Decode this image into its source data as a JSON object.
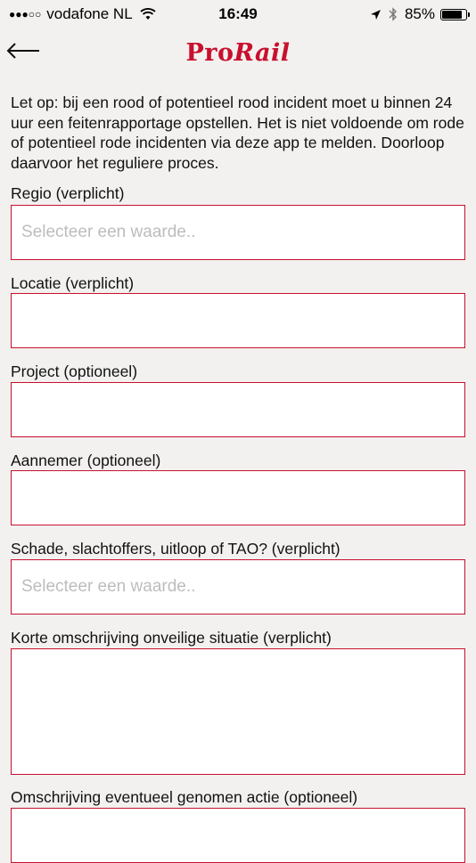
{
  "status_bar": {
    "carrier": "vodafone NL",
    "time": "16:49",
    "battery": "85%",
    "battery_level": 0.85
  },
  "header": {
    "logo_part1": "Pro",
    "logo_part2": "Rail"
  },
  "notice": "Let op: bij een rood of potentieel rood incident moet u binnen 24 uur een feitenrapportage opstellen. Het is niet voldoende om rode of potentieel rode incidenten via deze app te melden. Doorloop daarvoor het reguliere proces.",
  "form": {
    "regio_label": "Regio (verplicht)",
    "regio_placeholder": "Selecteer een waarde..",
    "locatie_label": "Locatie (verplicht)",
    "project_label": "Project (optioneel)",
    "aannemer_label": "Aannemer (optioneel)",
    "schade_label": "Schade, slachtoffers, uitloop of TAO? (verplicht)",
    "schade_placeholder": "Selecteer een waarde..",
    "omschrijving_label": "Korte omschrijving onveilige situatie (verplicht)",
    "actie_label": "Omschrijving eventueel genomen actie (optioneel)"
  },
  "colors": {
    "accent": "#c8102e",
    "background": "#f2f1ef",
    "placeholder": "#bdbdbd"
  }
}
